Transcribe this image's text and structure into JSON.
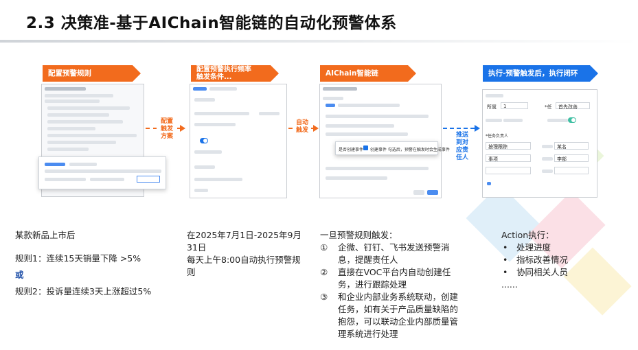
{
  "title": "2.3 决策准-基于AIChain智能链的自动化预警体系",
  "banners": {
    "step1": "配置预警规则",
    "step2": "配置预警执行频率\n触发条件...",
    "step3": "AIChain智能链",
    "step4": "执行-预警触发后，执行闭环"
  },
  "connectors": {
    "c1": "配置\n触发\n方案",
    "c2": "自动\n触发",
    "c3": "推送\n到对\n应责\n任人"
  },
  "screens": {
    "s3_popup_option1": "是否创建事件",
    "s3_popup_option2": "创建事件 勾选后，预警在触发时会生成事件",
    "s4_row1_label": "所属",
    "s4_row1_value": "1",
    "s4_row1_label2": "*任",
    "s4_row1_value2": "首先改善",
    "s4_owner_label": "*任务负责人",
    "s4_owner_value": "按理跟踪",
    "s4_item": "事项",
    "s4_name1": "某名",
    "s4_name2": "李部"
  },
  "columns": {
    "col1": {
      "line1": "某款新品上市后",
      "line2": "规则1：连续15天销量下降 >5%",
      "line3": "或",
      "line4": "规则2：投诉量连续3天上涨超过5%"
    },
    "col2": {
      "text": "在2025年7月1日-2025年9月31日\n每天上午8:00自动执行预警规则"
    },
    "col3": {
      "intro": "一旦预警规则触发：",
      "items": [
        {
          "n": "①",
          "text": "企微、钉钉、飞书发送预警消息，提醒责任人"
        },
        {
          "n": "②",
          "text": "直接在VOC平台内自动创建任务，进行跟踪处理"
        },
        {
          "n": "③",
          "text": "和企业内部业务系统联动，创建任务，如有关于产品质量缺陷的抱怨，可以联动企业内部质量管理系统进行处理"
        }
      ]
    },
    "col4": {
      "heading": "Action执行：",
      "items": [
        "处理进度",
        "指标改善情况",
        "协同相关人员"
      ],
      "ellipsis": "......"
    }
  },
  "colors": {
    "orange": "#f26b1d",
    "blue": "#1a73e8",
    "emphasis_or": "#1f4fa8"
  }
}
